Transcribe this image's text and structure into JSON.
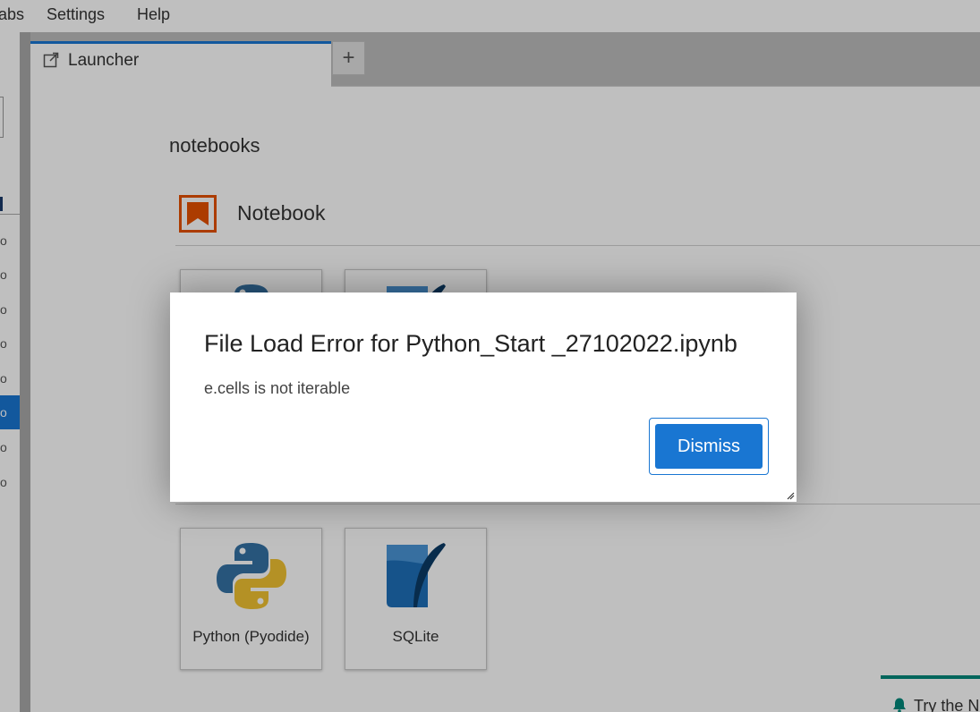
{
  "menubar": {
    "items": [
      {
        "label": "abs"
      },
      {
        "label": "Settings"
      },
      {
        "label": "Help"
      }
    ]
  },
  "sidebar": {
    "rows": [
      {
        "label": "o"
      },
      {
        "label": "o"
      },
      {
        "label": "o"
      },
      {
        "label": "o"
      },
      {
        "label": "o"
      },
      {
        "label": "o"
      },
      {
        "label": "o"
      },
      {
        "label": "o"
      }
    ],
    "active_index": 5
  },
  "tabs": {
    "launcher_label": "Launcher",
    "new_tab_label": "+"
  },
  "launcher": {
    "cwd": "notebooks",
    "section_notebook_label": "Notebook",
    "kernels": [
      {
        "label": "Python (Pyodide)",
        "icon": "python-icon"
      },
      {
        "label": "SQLite",
        "icon": "sqlite-feather-icon"
      }
    ]
  },
  "dialog": {
    "title": "File Load Error for Python_Start _27102022.ipynb",
    "body": "e.cells is not iterable",
    "dismiss_label": "Dismiss"
  },
  "toast": {
    "text": "Try the N"
  },
  "colors": {
    "accent": "#1976d2",
    "notebook_orange": "#e65100",
    "toast_teal": "#00897b"
  }
}
